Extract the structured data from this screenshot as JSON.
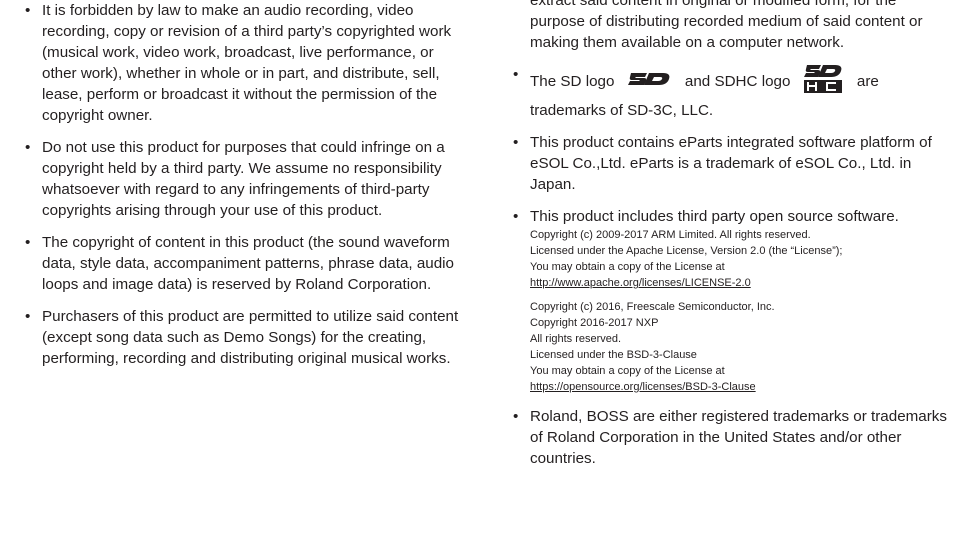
{
  "left_bullets": [
    "It is forbidden by law to make an audio recording, video recording, copy or revision of a third party’s copyrighted work (musical work, video work, broadcast, live performance, or other work), whether in whole or in part, and distribute, sell, lease, perform or broadcast it without the permission of the copyright owner.",
    "Do not use this product for purposes that could infringe on a copyright held by a third party. We assume no responsibility whatsoever with regard to any infringements of third-party copyrights arising through your use of this product.",
    "The copyright of content in this product (the sound waveform data, style data, accompaniment patterns, phrase data, audio loops and image data) is reserved by Roland Corporation.",
    "Purchasers of this product are permitted to utilize said content (except song data such as Demo Songs) for the creating, performing, recording and distributing original musical works."
  ],
  "right": {
    "continuation": "extract said content in original or modified form, for the purpose of distributing recorded medium of said content or making them available on a computer network.",
    "sd_text_before": "The SD logo",
    "sd_text_middle": "and SDHC logo",
    "sd_text_after": "are",
    "sd_text_line2": "trademarks of SD-3C, LLC.",
    "sd_logo_alt": "SD",
    "sdhc_logo_alt": "SD HC",
    "eparts": "This product contains eParts integrated software platform of eSOL Co.,Ltd. eParts is a trademark of eSOL Co., Ltd. in Japan.",
    "oss_intro": "This product includes third party open source software.",
    "arm_lines": [
      "Copyright (c) 2009-2017 ARM Limited. All rights reserved.",
      "Licensed under the Apache License, Version 2.0 (the “License”);",
      "You may obtain a copy of the License at"
    ],
    "arm_link": "http://www.apache.org/licenses/LICENSE-2.0",
    "nxp_lines": [
      "Copyright (c) 2016, Freescale Semiconductor, Inc.",
      "Copyright 2016-2017 NXP",
      "All rights reserved.",
      "Licensed under the BSD-3-Clause",
      "You may obtain a copy of the License at"
    ],
    "nxp_link": "https://opensource.org/licenses/BSD-3-Clause",
    "roland": "Roland, BOSS are either registered trademarks or trademarks of Roland Corporation in the United States and/or other countries."
  }
}
